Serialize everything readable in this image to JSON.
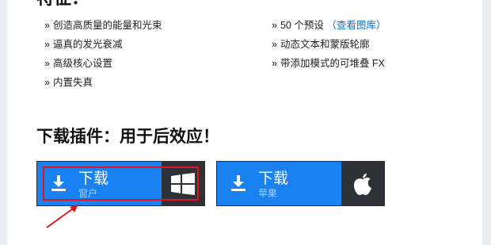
{
  "features": {
    "title": "特征：",
    "bullet": "»",
    "left": [
      "创造高质量的能量和光束",
      "逼真的发光衰减",
      "高级核心设置",
      "内置失真"
    ],
    "right": [
      {
        "text": "50 个预设",
        "link": "（查看图库）"
      },
      {
        "text": "动态文本和蒙版轮廓"
      },
      {
        "text": "带添加模式的可堆叠 FX"
      }
    ]
  },
  "download": {
    "title": "下载插件：用于后效应！",
    "buttons": [
      {
        "label": "下载",
        "platform": "窗户",
        "os_icon": "windows-icon"
      },
      {
        "label": "下载",
        "platform": "苹果",
        "os_icon": "apple-icon"
      }
    ]
  },
  "colors": {
    "button_blue": "#1a82f0",
    "os_panel": "#2e3238",
    "link": "#0a6fd1",
    "annotation_red": "#e0141a"
  }
}
